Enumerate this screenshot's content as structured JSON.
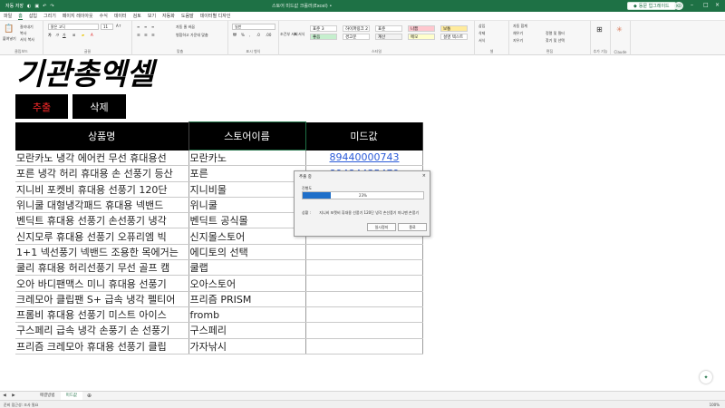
{
  "titlebar": {
    "autosave": "자동 저장",
    "doc_title": "스토어 미드값 크롤러(Excel) •",
    "login_label": "동문 업그레이드",
    "avatar": "KO"
  },
  "ribbon_tabs": [
    "파일",
    "홈",
    "삽입",
    "그리기",
    "페이지 레이아웃",
    "수식",
    "데이터",
    "검토",
    "보기",
    "자동화",
    "도움말",
    "데이터별 디자인"
  ],
  "ribbon": {
    "clipboard": {
      "paste": "붙여넣기",
      "cut": "잘라내기",
      "copy": "복사",
      "format_painter": "서식 복사",
      "label": "클립보드"
    },
    "font": {
      "font_name": "맑은 고딕",
      "font_size": "11",
      "label": "글꼴"
    },
    "alignment": {
      "wrap": "자동 줄 바꿈",
      "merge": "병합하고 가운데 맞춤",
      "label": "맞춤"
    },
    "number": {
      "format": "일반",
      "label": "표시 형식"
    },
    "styles": {
      "conditional": "조건부 서식",
      "table": "표 서식",
      "cells": [
        {
          "text": "표준 3",
          "color": "#ffffff"
        },
        {
          "text": "하이퍼링크 2",
          "color": "#ffffff"
        },
        {
          "text": "표준",
          "color": "#ffffff"
        },
        {
          "text": "나쁨",
          "color": "#ffc7ce"
        },
        {
          "text": "보통",
          "color": "#ffeb9c"
        },
        {
          "text": "좋음",
          "color": "#c6efce"
        },
        {
          "text": "경고문",
          "color": "#ffffff"
        },
        {
          "text": "계산",
          "color": "#f2f2f2"
        },
        {
          "text": "메모",
          "color": "#ffffcc"
        },
        {
          "text": "설명 텍스트",
          "color": "#ffffff"
        }
      ],
      "label": "스타일"
    },
    "cells_group": {
      "insert": "삽입",
      "delete": "삭제",
      "format": "서식",
      "label": "셀"
    },
    "editing": {
      "autosum": "자동 합계",
      "fill": "채우기",
      "clear": "지우기",
      "sort": "정렬 및 필터",
      "find": "찾기 및 선택",
      "label": "편집"
    },
    "addins": {
      "label": "추가 기능"
    },
    "claude": {
      "label": "Claude"
    }
  },
  "sheet": {
    "logo_text": "기관총엑셀",
    "extract_button": "추출",
    "delete_button": "삭제",
    "headers": [
      "상품명",
      "스토어이름",
      "미드값"
    ],
    "rows": [
      {
        "product": "모란카노 냉각 에어컨 무선 휴대용선",
        "store": "모란카노",
        "mid": "89440000743"
      },
      {
        "product": "포른 냉각 허리 휴대용 손 선풍기 등산",
        "store": "포른",
        "mid": "89484435479"
      },
      {
        "product": "지니비 포켓비 휴대용 선풍기 120단",
        "store": "지니비몰",
        "mid": ""
      },
      {
        "product": "위니쿨 대형냉각패드 휴대용 넥밴드",
        "store": "위니쿨",
        "mid": ""
      },
      {
        "product": "벤딕트 휴대용 선풍기 손선풍기 냉각",
        "store": "벤딕트 공식몰",
        "mid": ""
      },
      {
        "product": "신지모루 휴대용 선풍기 오퓨리엠 빅",
        "store": "신지몰스토어",
        "mid": ""
      },
      {
        "product": "1+1 넥선풍기 넥밴드 조용한 목에거는",
        "store": "에디토의 선택",
        "mid": ""
      },
      {
        "product": "쿨리 휴대용 허리선풍기 무선 골프 캠",
        "store": "쿨랩",
        "mid": ""
      },
      {
        "product": "오아 바디팬맥스 미니 휴대용 선풍기",
        "store": "오아스토어",
        "mid": ""
      },
      {
        "product": "크레모아 클립팬 S+ 급속 냉각 펠티어",
        "store": "프리즘 PRISM",
        "mid": ""
      },
      {
        "product": "프롬비 휴대용 선풍기 미스트 아이스",
        "store": "fromb",
        "mid": ""
      },
      {
        "product": "구스페리 급속 냉각 손풍기 손 선풍기",
        "store": "구스페리",
        "mid": ""
      },
      {
        "product": "프리즘 크레모아 휴대용 선풍기 클립",
        "store": "가자낚시",
        "mid": ""
      }
    ]
  },
  "dialog": {
    "title": "추출 중",
    "progress_label": "진행도",
    "progress_percent": 23,
    "progress_text": "23%",
    "status_label": "상황 :",
    "status_text": "지니비 포켓비 휴대용 선풍기 120단 냉각 손선풍기 미니팬 손풍기",
    "pause_button": "일시정지",
    "close_button": "종료"
  },
  "sheet_tabs": {
    "tabs": [
      "매결방법",
      "미드값"
    ],
    "active": "미드값"
  },
  "statusbar": {
    "left": "준비   접근성: 조사 필요",
    "right": "100%"
  },
  "colors": {
    "excel_green": "#1e7145",
    "progress_blue": "#1f6fc9",
    "extract_red": "#ff2a2a"
  }
}
